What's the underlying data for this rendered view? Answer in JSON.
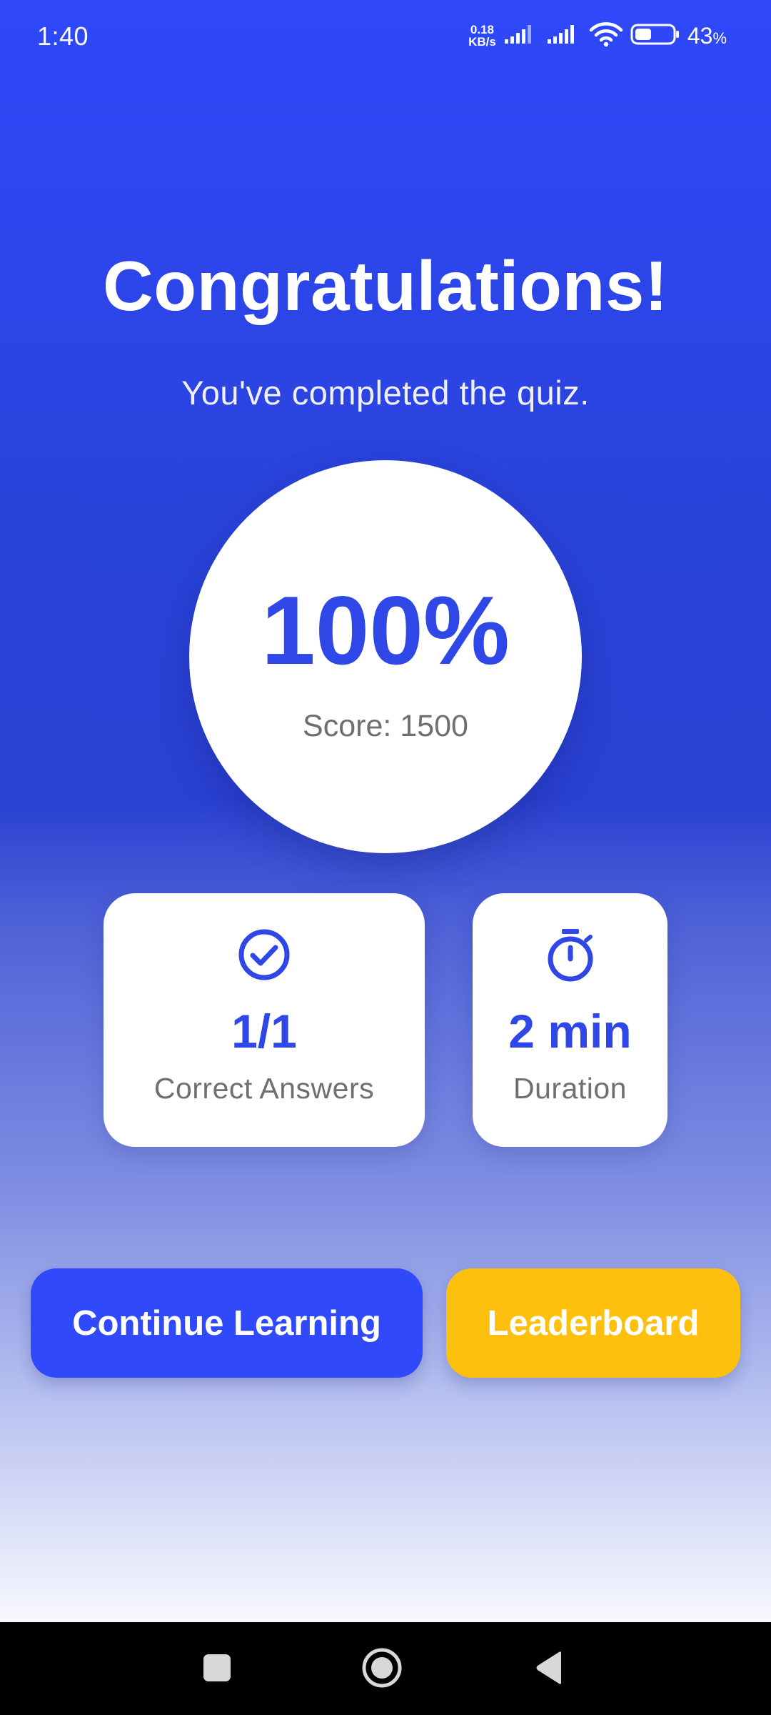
{
  "status_bar": {
    "time": "1:40",
    "net_speed_value": "0.18",
    "net_speed_unit": "KB/s",
    "battery_percent": "43",
    "battery_percent_sign": "%",
    "icons": [
      "signal-icon",
      "signal-icon",
      "wifi-icon",
      "battery-icon"
    ]
  },
  "header": {
    "title": "Congratulations!",
    "subtitle": "You've completed the quiz."
  },
  "score": {
    "percent": "100%",
    "points_label": "Score: 1500"
  },
  "stats": {
    "correct": {
      "icon": "check-circle-icon",
      "value": "1/1",
      "label": "Correct Answers"
    },
    "duration": {
      "icon": "stopwatch-icon",
      "value": "2 min",
      "label": "Duration"
    }
  },
  "actions": {
    "continue_label": "Continue Learning",
    "leaderboard_label": "Leaderboard"
  },
  "colors": {
    "accent": "#2f49fb",
    "accent_text": "#2e47e6",
    "leaderboard": "#fdc00e",
    "muted_text": "#6f6f6f"
  },
  "nav_bar": {
    "icons": [
      "recents-square-icon",
      "home-circle-icon",
      "back-triangle-icon"
    ]
  }
}
